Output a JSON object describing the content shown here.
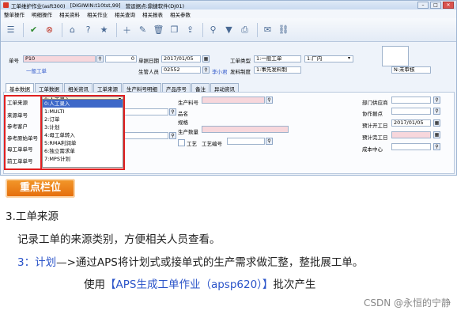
{
  "window": {
    "title_parts": [
      "工单维护作业(asft300)",
      "[DIGIWIN:t10tst,99]",
      "营运据点:鼎捷软件(DJ01)"
    ],
    "menu": [
      "整单操作",
      "明细操作",
      "相关资料",
      "相关作业",
      "相关查询",
      "相关报表",
      "相关参数"
    ]
  },
  "toolbar": {
    "icons": [
      "menu-icon",
      "confirm-icon",
      "cancel-icon",
      "home-icon",
      "help-icon",
      "favorite-icon",
      "add-icon",
      "edit-icon",
      "delete-icon",
      "copy-icon",
      "export-icon",
      "query-icon",
      "filter-icon",
      "print-icon",
      "attach-icon",
      "link-icon"
    ]
  },
  "header": {
    "doc_no_label": "单号",
    "doc_no": "P10",
    "doc_no_qty": "0",
    "doc_date_label": "单据日期",
    "doc_date": "2017/01/05",
    "type_label": "工单类型",
    "type_value": "1:一般工单",
    "factory_value": "1:厂内",
    "general_label": "一般工单",
    "user_label": "生管人员",
    "user_code": "02552",
    "user_name": "李小君",
    "issue_label": "发料制度",
    "issue_value": "1:事先发料制",
    "status_value": "N:未审核"
  },
  "tabs": [
    "基本数据",
    "工单数据",
    "相关资讯",
    "工单来源",
    "生产料号明细",
    "产品序号",
    "备注",
    "异动资讯"
  ],
  "basic": {
    "source_label": "工单来源",
    "source_value": "0:人工录入",
    "source_no_label": "来源单号",
    "ref_customer_label": "参考客户",
    "ref_source_label": "参考原始单号",
    "parent_label": "母工单单号",
    "prev_label": "前工单单号",
    "source_options": [
      "0:人工录入",
      "1:MULTI",
      "2:订单",
      "3:计划",
      "4:母工单转入",
      "5:RMA利润单",
      "6:独立需求单",
      "7:MPS计划"
    ],
    "item_label": "生产料号",
    "name_label": "品名",
    "spec_label": "规格",
    "qty_label": "生产数量",
    "process_label": "工艺",
    "process_no_label": "工艺编号",
    "dept_label": "部门供应商",
    "dept_name_label": "协作据点",
    "plan_start_label": "预计开工日",
    "plan_start": "2017/01/05",
    "plan_end_label": "预计完工日",
    "cost_label": "成本中心"
  },
  "notes": {
    "badge": "重点栏位",
    "line1": "3.工单来源",
    "line2": "记录工单的来源类别，方便相关人员查看。",
    "line3_prefix": "3：计划",
    "line3_rest": "—>通过APS将计划式或接单式的生产需求做汇整，整批展工单。",
    "line4_prefix": "使用",
    "line4_highlight": "【APS生成工单作业（apsp620）】",
    "line4_suffix": "批次产生",
    "watermark": "CSDN @永恒的宁静"
  },
  "colors": {
    "highlight_box": "#e02020",
    "badge": "#e46b0b",
    "link_blue": "#2b54c9",
    "required_field": "#f7d7dc"
  }
}
